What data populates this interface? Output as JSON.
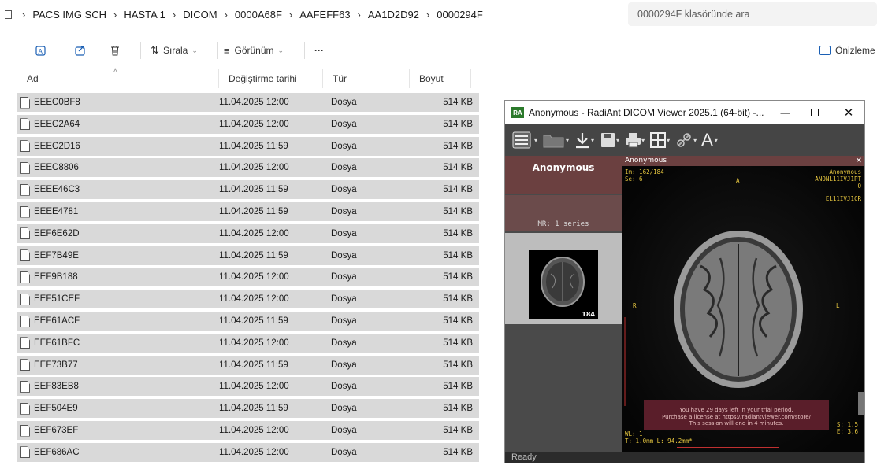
{
  "breadcrumb": [
    "PACS IMG SCH",
    "HASTA 1",
    "DICOM",
    "0000A68F",
    "AAFEFF63",
    "AA1D2D92",
    "0000294F"
  ],
  "search_placeholder": "0000294F klasöründe ara",
  "cmd": {
    "sort": "Sırala",
    "view": "Görünüm",
    "more": "···",
    "preview": "Önizleme"
  },
  "columns": [
    "Ad",
    "Değiştirme tarihi",
    "Tür",
    "Boyut"
  ],
  "files": [
    {
      "name": "EEEC0BF8",
      "date": "11.04.2025 12:00",
      "type": "Dosya",
      "size": "514 KB"
    },
    {
      "name": "EEEC2A64",
      "date": "11.04.2025 12:00",
      "type": "Dosya",
      "size": "514 KB"
    },
    {
      "name": "EEEC2D16",
      "date": "11.04.2025 11:59",
      "type": "Dosya",
      "size": "514 KB"
    },
    {
      "name": "EEEC8806",
      "date": "11.04.2025 12:00",
      "type": "Dosya",
      "size": "514 KB"
    },
    {
      "name": "EEEE46C3",
      "date": "11.04.2025 11:59",
      "type": "Dosya",
      "size": "514 KB"
    },
    {
      "name": "EEEE4781",
      "date": "11.04.2025 11:59",
      "type": "Dosya",
      "size": "514 KB"
    },
    {
      "name": "EEF6E62D",
      "date": "11.04.2025 12:00",
      "type": "Dosya",
      "size": "514 KB"
    },
    {
      "name": "EEF7B49E",
      "date": "11.04.2025 11:59",
      "type": "Dosya",
      "size": "514 KB"
    },
    {
      "name": "EEF9B188",
      "date": "11.04.2025 12:00",
      "type": "Dosya",
      "size": "514 KB"
    },
    {
      "name": "EEF51CEF",
      "date": "11.04.2025 12:00",
      "type": "Dosya",
      "size": "514 KB"
    },
    {
      "name": "EEF61ACF",
      "date": "11.04.2025 11:59",
      "type": "Dosya",
      "size": "514 KB"
    },
    {
      "name": "EEF61BFC",
      "date": "11.04.2025 12:00",
      "type": "Dosya",
      "size": "514 KB"
    },
    {
      "name": "EEF73B77",
      "date": "11.04.2025 11:59",
      "type": "Dosya",
      "size": "514 KB"
    },
    {
      "name": "EEF83EB8",
      "date": "11.04.2025 12:00",
      "type": "Dosya",
      "size": "514 KB"
    },
    {
      "name": "EEF504E9",
      "date": "11.04.2025 11:59",
      "type": "Dosya",
      "size": "514 KB"
    },
    {
      "name": "EEF673EF",
      "date": "11.04.2025 12:00",
      "type": "Dosya",
      "size": "514 KB"
    },
    {
      "name": "EEF686AC",
      "date": "11.04.2025 12:00",
      "type": "Dosya",
      "size": "514 KB"
    }
  ],
  "viewer": {
    "title": "Anonymous - RadiAnt DICOM Viewer 2025.1 (64-bit) -...",
    "app_icon": "RA",
    "patient": "Anonymous",
    "study": "MR: 1 series",
    "thumb_count": "184",
    "tab_title": "Anonymous",
    "im": "Im: 162/184",
    "se": "Se: 6",
    "orient_top": "A",
    "orient_left": "R",
    "orient_right": "L",
    "tr_name": "Anonymous",
    "tr_id": "ANONL11IVJ1PT",
    "tr_o": "O",
    "tr_code": "EL11IVJ1CR",
    "trial_1": "You have 29 days left in your trial period.",
    "trial_2": "Purchase a license at https://radiantviewer.com/store/",
    "trial_3": "This session will end in 4 minutes.",
    "wl": "WL: 1",
    "thickness": "T: 1.0mm L: 94.2mm*",
    "s_val": "S: 1.5",
    "e_val": "E: 3.6",
    "status": "Ready"
  }
}
